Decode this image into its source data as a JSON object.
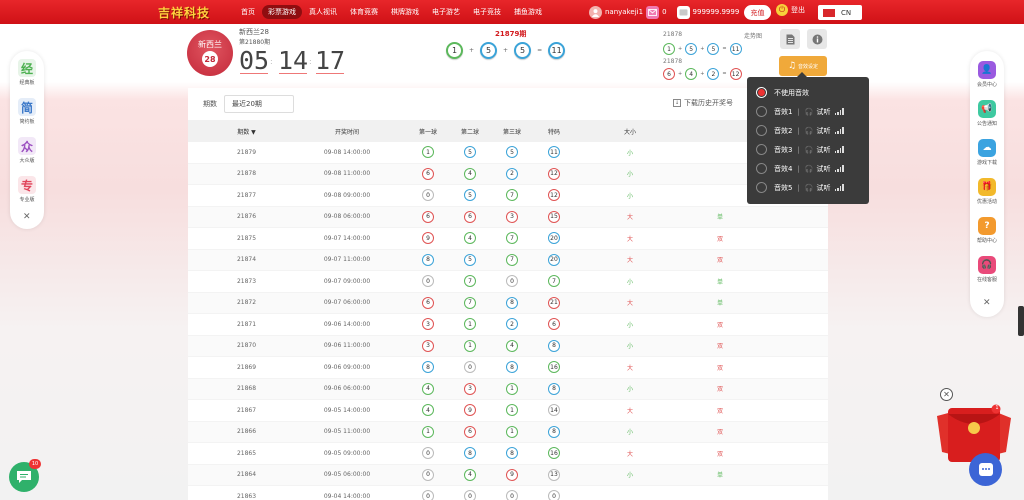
{
  "header": {
    "logo": "吉祥科技",
    "nav": [
      "首页",
      "彩票游戏",
      "真人视讯",
      "体育竞赛",
      "棋牌游戏",
      "电子游艺",
      "电子竞技",
      "捕鱼游戏"
    ],
    "username": "nanyakeji1",
    "messages": "0",
    "balance": "999999.9999",
    "recharge": "充值",
    "logout": "登出",
    "lang": "CN"
  },
  "lottery": {
    "logo_name": "新西兰",
    "logo_num": "28",
    "name": "新西兰28",
    "issue": "第21880期",
    "countdown": [
      "05",
      "14",
      "17"
    ],
    "current_issue": "21879期",
    "current_balls": [
      "1",
      "5",
      "5",
      "11"
    ],
    "current_ops": [
      "+",
      "+",
      "="
    ],
    "history": [
      {
        "issue": "21878",
        "balls": [
          "1",
          "5",
          "5",
          "11"
        ],
        "ops": [
          "+",
          "+",
          "="
        ]
      },
      {
        "issue": "21878",
        "balls": [
          "6",
          "4",
          "2",
          "12"
        ],
        "ops": [
          "+",
          "+",
          "="
        ]
      }
    ],
    "trend_label": "走势图",
    "sound_btn": "音效设定"
  },
  "table": {
    "filter_label": "期数",
    "filter_value": "最近20期",
    "download": "下载历史开奖号",
    "headers": {
      "issue": "期数 ▼",
      "time": "开奖时间",
      "b1": "第一球",
      "b2": "第二球",
      "b3": "第三球",
      "sum": "特码",
      "size": "大小"
    },
    "rows": [
      {
        "issue": "21879",
        "time": "09-08 14:00:00",
        "b": [
          "1",
          "5",
          "5",
          "11"
        ],
        "c": [
          "g",
          "b",
          "b",
          "b"
        ],
        "size": "小",
        "sc": "s-small",
        "oe": "",
        "oec": ""
      },
      {
        "issue": "21878",
        "time": "09-08 11:00:00",
        "b": [
          "6",
          "4",
          "2",
          "12"
        ],
        "c": [
          "r",
          "g",
          "b",
          "r"
        ],
        "size": "小",
        "sc": "s-small",
        "oe": "",
        "oec": ""
      },
      {
        "issue": "21877",
        "time": "09-08 09:00:00",
        "b": [
          "0",
          "5",
          "7",
          "12"
        ],
        "c": [
          "x",
          "b",
          "g",
          "r"
        ],
        "size": "小",
        "sc": "s-small",
        "oe": "",
        "oec": ""
      },
      {
        "issue": "21876",
        "time": "09-08 06:00:00",
        "b": [
          "6",
          "6",
          "3",
          "15"
        ],
        "c": [
          "r",
          "r",
          "r",
          "r"
        ],
        "size": "大",
        "sc": "s-big",
        "oe": "单",
        "oec": "oe-even"
      },
      {
        "issue": "21875",
        "time": "09-07 14:00:00",
        "b": [
          "9",
          "4",
          "7",
          "20"
        ],
        "c": [
          "r",
          "g",
          "g",
          "b"
        ],
        "size": "大",
        "sc": "s-big",
        "oe": "双",
        "oec": "oe-odd"
      },
      {
        "issue": "21874",
        "time": "09-07 11:00:00",
        "b": [
          "8",
          "5",
          "7",
          "20"
        ],
        "c": [
          "b",
          "b",
          "g",
          "b"
        ],
        "size": "大",
        "sc": "s-big",
        "oe": "双",
        "oec": "oe-odd"
      },
      {
        "issue": "21873",
        "time": "09-07 09:00:00",
        "b": [
          "0",
          "7",
          "0",
          "7"
        ],
        "c": [
          "x",
          "g",
          "x",
          "g"
        ],
        "size": "小",
        "sc": "s-small",
        "oe": "单",
        "oec": "oe-even"
      },
      {
        "issue": "21872",
        "time": "09-07 06:00:00",
        "b": [
          "6",
          "7",
          "8",
          "21"
        ],
        "c": [
          "r",
          "g",
          "b",
          "r"
        ],
        "size": "大",
        "sc": "s-big",
        "oe": "单",
        "oec": "oe-even"
      },
      {
        "issue": "21871",
        "time": "09-06 14:00:00",
        "b": [
          "3",
          "1",
          "2",
          "6"
        ],
        "c": [
          "r",
          "g",
          "b",
          "r"
        ],
        "size": "小",
        "sc": "s-small",
        "oe": "双",
        "oec": "oe-odd"
      },
      {
        "issue": "21870",
        "time": "09-06 11:00:00",
        "b": [
          "3",
          "1",
          "4",
          "8"
        ],
        "c": [
          "r",
          "g",
          "g",
          "b"
        ],
        "size": "小",
        "sc": "s-small",
        "oe": "双",
        "oec": "oe-odd"
      },
      {
        "issue": "21869",
        "time": "09-06 09:00:00",
        "b": [
          "8",
          "0",
          "8",
          "16"
        ],
        "c": [
          "b",
          "x",
          "b",
          "g"
        ],
        "size": "大",
        "sc": "s-big",
        "oe": "双",
        "oec": "oe-odd"
      },
      {
        "issue": "21868",
        "time": "09-06 06:00:00",
        "b": [
          "4",
          "3",
          "1",
          "8"
        ],
        "c": [
          "g",
          "r",
          "g",
          "b"
        ],
        "size": "小",
        "sc": "s-small",
        "oe": "双",
        "oec": "oe-odd"
      },
      {
        "issue": "21867",
        "time": "09-05 14:00:00",
        "b": [
          "4",
          "9",
          "1",
          "14"
        ],
        "c": [
          "g",
          "r",
          "g",
          "x"
        ],
        "size": "大",
        "sc": "s-big",
        "oe": "双",
        "oec": "oe-odd"
      },
      {
        "issue": "21866",
        "time": "09-05 11:00:00",
        "b": [
          "1",
          "6",
          "1",
          "8"
        ],
        "c": [
          "g",
          "r",
          "g",
          "b"
        ],
        "size": "小",
        "sc": "s-small",
        "oe": "双",
        "oec": "oe-odd"
      },
      {
        "issue": "21865",
        "time": "09-05 09:00:00",
        "b": [
          "0",
          "8",
          "8",
          "16"
        ],
        "c": [
          "x",
          "b",
          "b",
          "g"
        ],
        "size": "大",
        "sc": "s-big",
        "oe": "双",
        "oec": "oe-odd"
      },
      {
        "issue": "21864",
        "time": "09-05 06:00:00",
        "b": [
          "0",
          "4",
          "9",
          "13"
        ],
        "c": [
          "x",
          "g",
          "r",
          "x"
        ],
        "size": "小",
        "sc": "s-small",
        "oe": "单",
        "oec": "oe-even"
      },
      {
        "issue": "21863",
        "time": "09-04 14:00:00",
        "b": [
          "0",
          "0",
          "0",
          "0"
        ],
        "c": [
          "x",
          "x",
          "x",
          "x"
        ],
        "size": "",
        "sc": "",
        "oe": "",
        "oec": ""
      }
    ]
  },
  "sound_menu": {
    "items": [
      {
        "label": "不使用音效",
        "checked": true,
        "listen": false
      },
      {
        "label": "音效1",
        "checked": false,
        "listen": true
      },
      {
        "label": "音效2",
        "checked": false,
        "listen": true
      },
      {
        "label": "音效3",
        "checked": false,
        "listen": true
      },
      {
        "label": "音效4",
        "checked": false,
        "listen": true
      },
      {
        "label": "音效5",
        "checked": false,
        "listen": true
      }
    ],
    "listen_label": "试听"
  },
  "left_sidebar": [
    {
      "icon": "经",
      "label": "经典板",
      "color": "#4cb050"
    },
    {
      "icon": "简",
      "label": "简约板",
      "color": "#3b78c8"
    },
    {
      "icon": "众",
      "label": "大众版",
      "color": "#9b4fc0"
    },
    {
      "icon": "专",
      "label": "专业版",
      "color": "#e0435a"
    }
  ],
  "right_sidebar": [
    {
      "label": "会员中心",
      "color": "#9a5ae0",
      "icon": "user-icon"
    },
    {
      "label": "公告通知",
      "color": "#3ec9a0",
      "icon": "megaphone-icon"
    },
    {
      "label": "游戏下载",
      "color": "#3ba3e0",
      "icon": "cloud-download-icon"
    },
    {
      "label": "优惠活动",
      "color": "#f2b92b",
      "icon": "gift-icon"
    },
    {
      "label": "帮助中心",
      "color": "#f39a2e",
      "icon": "question-icon"
    },
    {
      "label": "在线客服",
      "color": "#e94a7a",
      "icon": "headset-icon"
    }
  ],
  "chat_badge": "10",
  "packet_badge": "1"
}
